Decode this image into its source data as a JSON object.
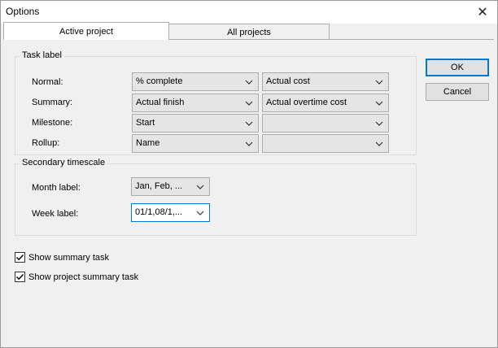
{
  "window": {
    "title": "Options",
    "close_glyph": "✕"
  },
  "tabs": [
    {
      "label": "Active project",
      "selected": true
    },
    {
      "label": "All projects",
      "selected": false
    }
  ],
  "task_label": {
    "title": "Task label",
    "rows": [
      {
        "label": "Normal:",
        "primary": "% complete",
        "secondary": "Actual cost"
      },
      {
        "label": "Summary:",
        "primary": "Actual finish",
        "secondary": "Actual overtime cost"
      },
      {
        "label": "Milestone:",
        "primary": "Start",
        "secondary": ""
      },
      {
        "label": "Rollup:",
        "primary": "Name",
        "secondary": ""
      }
    ]
  },
  "secondary_timescale": {
    "title": "Secondary timescale",
    "month_label": "Month label:",
    "month_value": "Jan, Feb, ...",
    "week_label": "Week label:",
    "week_value": "01/1,08/1,..."
  },
  "checkboxes": [
    {
      "label": "Show summary task",
      "checked": true
    },
    {
      "label": "Show project summary task",
      "checked": true
    }
  ],
  "buttons": {
    "ok": "OK",
    "cancel": "Cancel"
  },
  "colors": {
    "focus_accent": "#0078d7"
  }
}
